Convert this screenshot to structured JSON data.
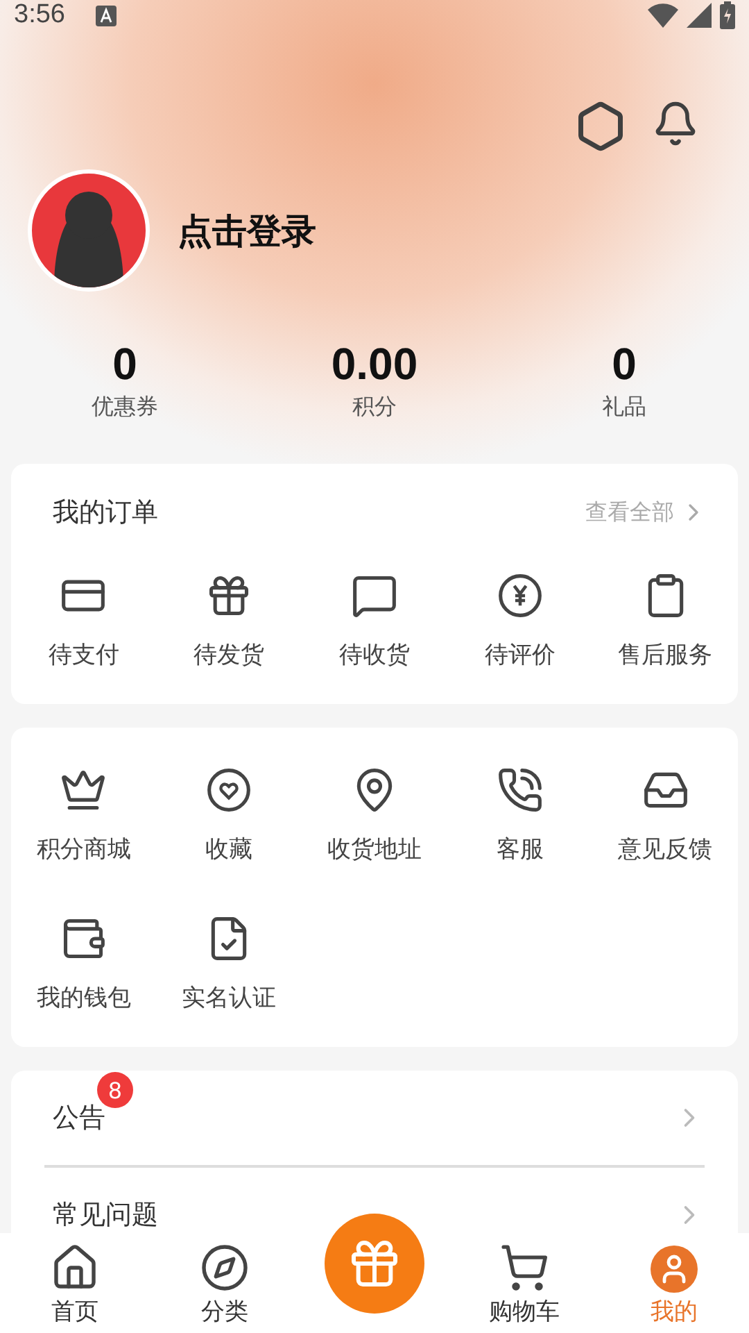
{
  "status_bar": {
    "time": "3:56"
  },
  "profile": {
    "login_text": "点击登录"
  },
  "stats": [
    {
      "value": "0",
      "label": "优惠券"
    },
    {
      "value": "0.00",
      "label": "积分"
    },
    {
      "value": "0",
      "label": "礼品"
    }
  ],
  "orders": {
    "title": "我的订单",
    "view_all": "查看全部",
    "items": [
      {
        "kind": "card",
        "label": "待支付"
      },
      {
        "kind": "gift",
        "label": "待发货"
      },
      {
        "kind": "message",
        "label": "待收货"
      },
      {
        "kind": "yen",
        "label": "待评价"
      },
      {
        "kind": "clipboard",
        "label": "售后服务"
      }
    ]
  },
  "services": [
    {
      "kind": "crown",
      "label": "积分商城"
    },
    {
      "kind": "heart",
      "label": "收藏"
    },
    {
      "kind": "pin",
      "label": "收货地址"
    },
    {
      "kind": "phone",
      "label": "客服"
    },
    {
      "kind": "inbox",
      "label": "意见反馈"
    },
    {
      "kind": "wallet",
      "label": "我的钱包"
    },
    {
      "kind": "verify",
      "label": "实名认证"
    }
  ],
  "list": [
    {
      "label": "公告",
      "badge": "8"
    },
    {
      "label": "常见问题"
    }
  ],
  "tab_bar": [
    {
      "kind": "home",
      "label": "首页",
      "selected": false
    },
    {
      "kind": "compass",
      "label": "分类",
      "selected": false
    },
    {
      "kind": "gift",
      "selected": false
    },
    {
      "kind": "cart",
      "label": "购物车",
      "selected": false
    },
    {
      "kind": "user",
      "label": "我的",
      "selected": true
    }
  ]
}
